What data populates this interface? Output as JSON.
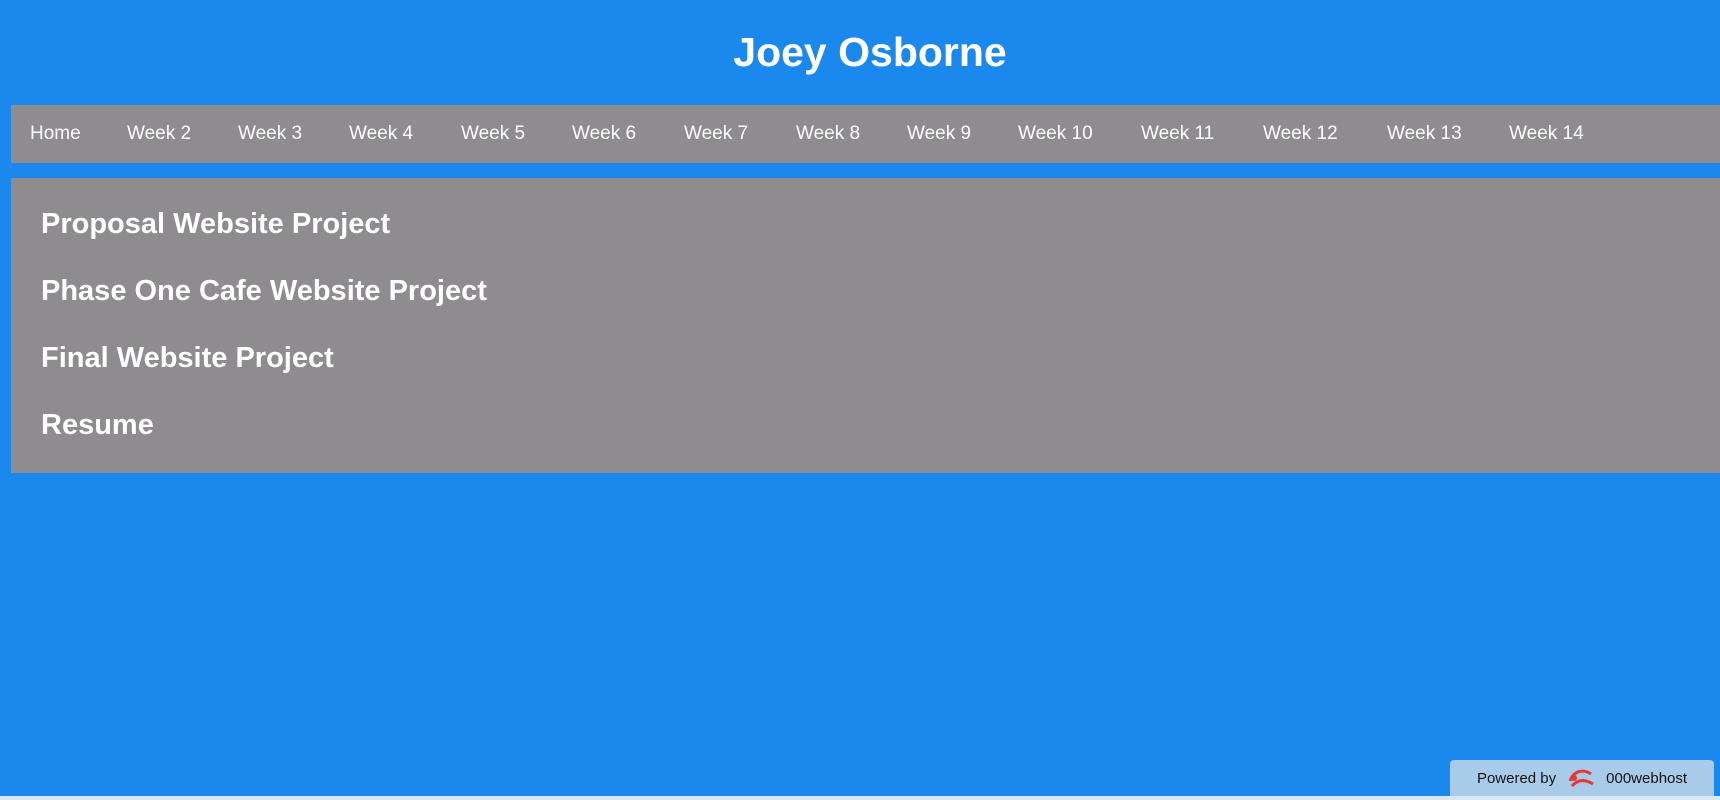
{
  "header": {
    "title": "Joey Osborne"
  },
  "nav": {
    "items": [
      {
        "label": "Home"
      },
      {
        "label": "Week 2"
      },
      {
        "label": "Week 3"
      },
      {
        "label": "Week 4"
      },
      {
        "label": "Week 5"
      },
      {
        "label": "Week 6"
      },
      {
        "label": "Week 7"
      },
      {
        "label": "Week 8"
      },
      {
        "label": "Week 9"
      },
      {
        "label": "Week 10"
      },
      {
        "label": "Week 11"
      },
      {
        "label": "Week 12"
      },
      {
        "label": "Week 13"
      },
      {
        "label": "Week 14"
      }
    ]
  },
  "main": {
    "links": [
      {
        "label": "Proposal Website Project"
      },
      {
        "label": "Phase One Cafe Website Project"
      },
      {
        "label": "Final Website Project"
      },
      {
        "label": "Resume"
      }
    ]
  },
  "footer": {
    "powered_label": "Powered by",
    "brand": "000webhost"
  },
  "colors": {
    "background": "#1b88ee",
    "panel": "#8e8c8f",
    "text": "#ffffff",
    "badge": "#a8cbea"
  },
  "icons": {
    "badge_logo": "webhost-logo-icon"
  }
}
